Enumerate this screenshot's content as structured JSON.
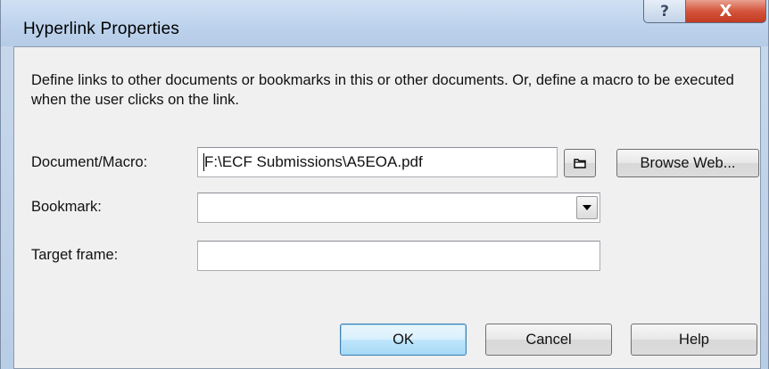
{
  "dialog": {
    "title": "Hyperlink Properties",
    "help_glyph": "?",
    "close_glyph": "X",
    "description": "Define links to other documents or bookmarks in this or other documents. Or, define a macro to be executed when the user clicks on the link."
  },
  "form": {
    "document_label": "Document/Macro:",
    "document_value": "F:\\ECF Submissions\\A5EOA.pdf",
    "browse_web_label": "Browse Web...",
    "bookmark_label": "Bookmark:",
    "bookmark_value": "",
    "target_frame_label": "Target frame:",
    "target_frame_value": ""
  },
  "buttons": {
    "ok": "OK",
    "cancel": "Cancel",
    "help": "Help"
  },
  "icons": {
    "browse_folder": "folder-icon",
    "combo_arrow": "chevron-down-icon"
  },
  "colors": {
    "close_button": "#c23a20",
    "default_button_border": "#3c7fb1",
    "titlebar": "#bcd2ec"
  }
}
